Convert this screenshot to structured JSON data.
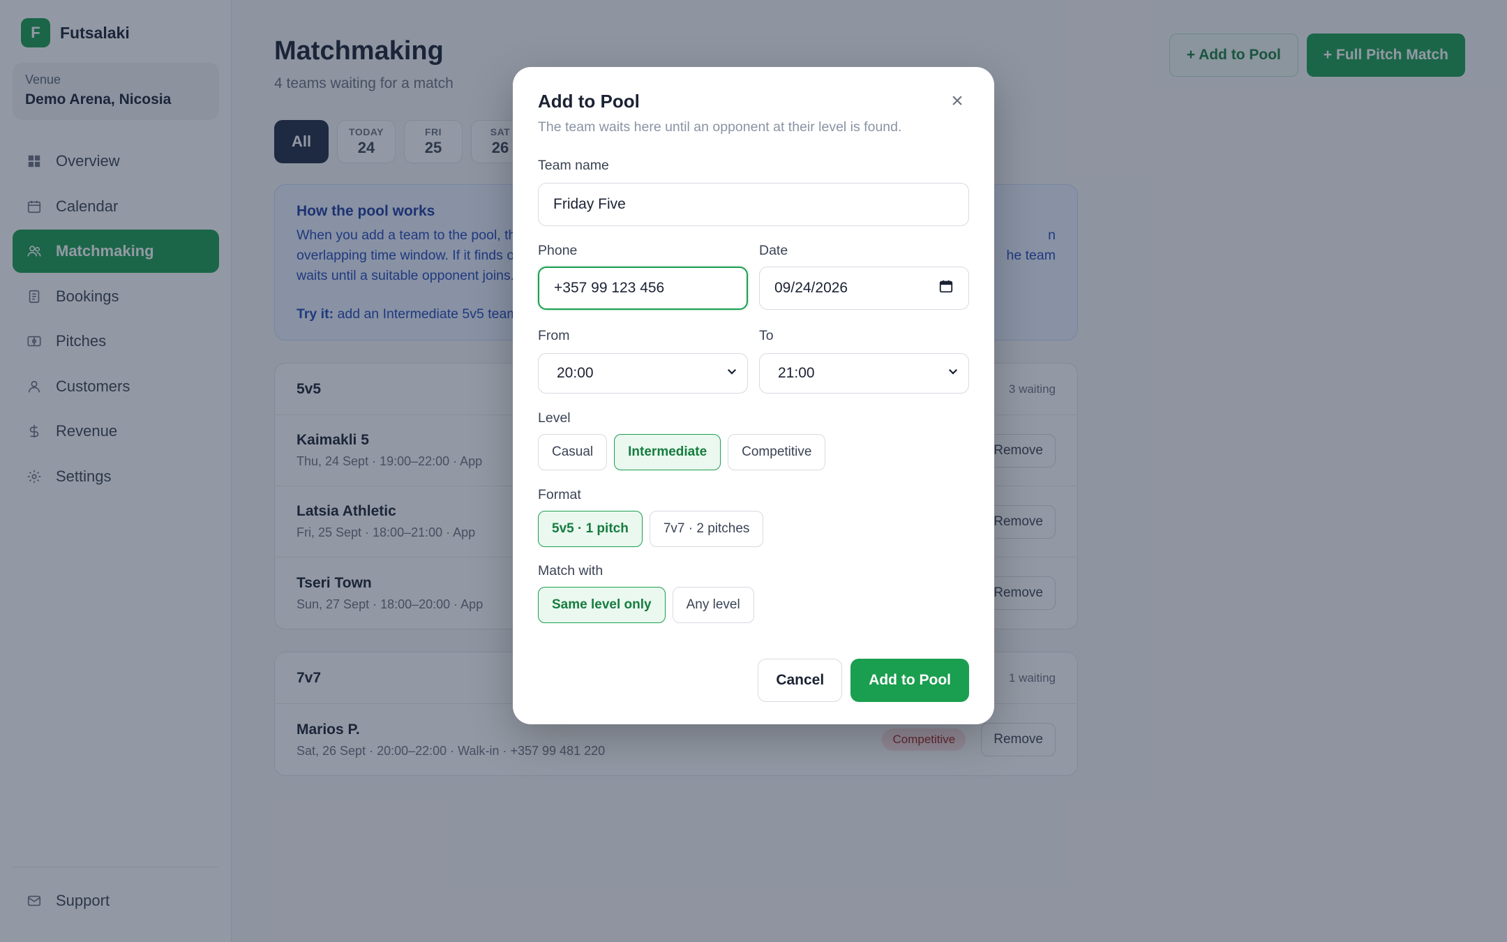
{
  "brand": {
    "logo_letter": "F",
    "name": "Futsalaki"
  },
  "venue": {
    "label": "Venue",
    "name": "Demo Arena, Nicosia"
  },
  "nav": {
    "items": [
      {
        "label": "Overview",
        "icon": "grid-icon"
      },
      {
        "label": "Calendar",
        "icon": "calendar-icon"
      },
      {
        "label": "Matchmaking",
        "icon": "users-icon",
        "active": true
      },
      {
        "label": "Bookings",
        "icon": "document-icon"
      },
      {
        "label": "Pitches",
        "icon": "pitch-icon"
      },
      {
        "label": "Customers",
        "icon": "user-icon"
      },
      {
        "label": "Revenue",
        "icon": "dollar-icon"
      },
      {
        "label": "Settings",
        "icon": "gear-icon"
      }
    ],
    "support": {
      "label": "Support",
      "icon": "mail-icon"
    }
  },
  "page": {
    "title": "Matchmaking",
    "subtitle": "4 teams waiting for a match",
    "actions": {
      "add_to_pool": "+ Add to Pool",
      "full_pitch": "+ Full Pitch Match"
    }
  },
  "date_filters": {
    "all": "All",
    "days": [
      {
        "name": "TODAY",
        "num": "24"
      },
      {
        "name": "FRI",
        "num": "25"
      },
      {
        "name": "SAT",
        "num": "26"
      }
    ]
  },
  "info": {
    "title": "How the pool works",
    "line1_left": "When you add a team to the pool, th",
    "line1_right": "n",
    "line2_left": "overlapping time window. If it finds o",
    "line2_right": "he team",
    "line3": "waits until a suitable opponent joins.",
    "try_label": "Try it:",
    "try_text": " add an Intermediate 5v5 team"
  },
  "groups": [
    {
      "name": "5v5",
      "count": "3 waiting",
      "rows": [
        {
          "name": "Kaimakli 5",
          "meta": "Thu, 24 Sept · 19:00–22:00 · App",
          "remove": "Remove"
        },
        {
          "name": "Latsia Athletic",
          "meta": "Fri, 25 Sept · 18:00–21:00 · App",
          "remove": "Remove"
        },
        {
          "name": "Tseri Town",
          "meta": "Sun, 27 Sept · 18:00–20:00 · App",
          "remove": "Remove"
        }
      ]
    },
    {
      "name": "7v7",
      "count": "1 waiting",
      "rows": [
        {
          "name": "Marios P.",
          "meta": "Sat, 26 Sept · 20:00–22:00 · Walk-in · +357 99 481 220",
          "badge": "Competitive",
          "remove": "Remove"
        }
      ]
    }
  ],
  "modal": {
    "title": "Add to Pool",
    "close": "×",
    "subtitle": "The team waits here until an opponent at their level is found.",
    "team_name": {
      "label": "Team name",
      "value": "Friday Five"
    },
    "phone": {
      "label": "Phone",
      "value": "+357 99 123 456"
    },
    "date": {
      "label": "Date",
      "value": "09/24/2026"
    },
    "from": {
      "label": "From",
      "value": "20:00"
    },
    "to": {
      "label": "To",
      "value": "21:00"
    },
    "level": {
      "label": "Level",
      "options": [
        "Casual",
        "Intermediate",
        "Competitive"
      ],
      "selected": "Intermediate"
    },
    "format": {
      "label": "Format",
      "options": [
        "5v5 · 1 pitch",
        "7v7 · 2 pitches"
      ],
      "selected": "5v5 · 1 pitch"
    },
    "match_with": {
      "label": "Match with",
      "options": [
        "Same level only",
        "Any level"
      ],
      "selected": "Same level only"
    },
    "cancel": "Cancel",
    "submit": "Add to Pool"
  },
  "colors": {
    "accent": "#1a9e4f",
    "info_bg": "#eaf1ff",
    "info_text": "#2447b8",
    "badge_competitive": "#fde2e2",
    "overlay": "rgba(30,41,64,0.48)"
  }
}
